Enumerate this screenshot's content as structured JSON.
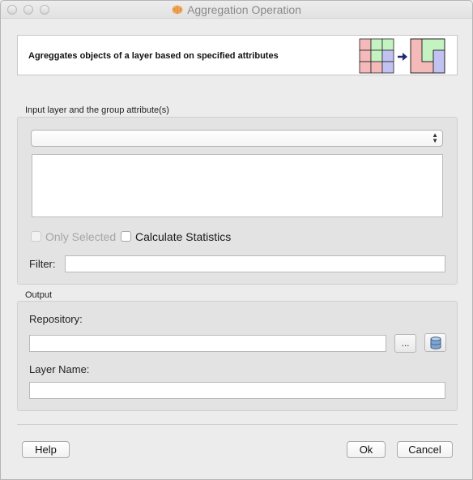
{
  "window": {
    "title": "Aggregation Operation"
  },
  "header": {
    "description": "Agreggates objects of a layer based on specified attributes",
    "graphic_icon": "aggregation-illustration-icon"
  },
  "input_group": {
    "label": "Input layer and the group attribute(s)",
    "layer_combo_value": "",
    "only_selected_label": "Only Selected",
    "only_selected_checked": false,
    "only_selected_enabled": false,
    "calc_stats_label": "Calculate Statistics",
    "calc_stats_checked": false,
    "filter_label": "Filter:",
    "filter_value": ""
  },
  "output_group": {
    "label": "Output",
    "repository_label": "Repository:",
    "repository_value": "",
    "browse_label": "...",
    "database_icon": "database-icon",
    "layer_name_label": "Layer Name:",
    "layer_name_value": ""
  },
  "buttons": {
    "help": "Help",
    "ok": "Ok",
    "cancel": "Cancel"
  },
  "colors": {
    "graphic_red": "#f4b9b9",
    "graphic_green": "#c4f2c0",
    "graphic_blue": "#c1c1f2",
    "arrow": "#1e2a78"
  }
}
